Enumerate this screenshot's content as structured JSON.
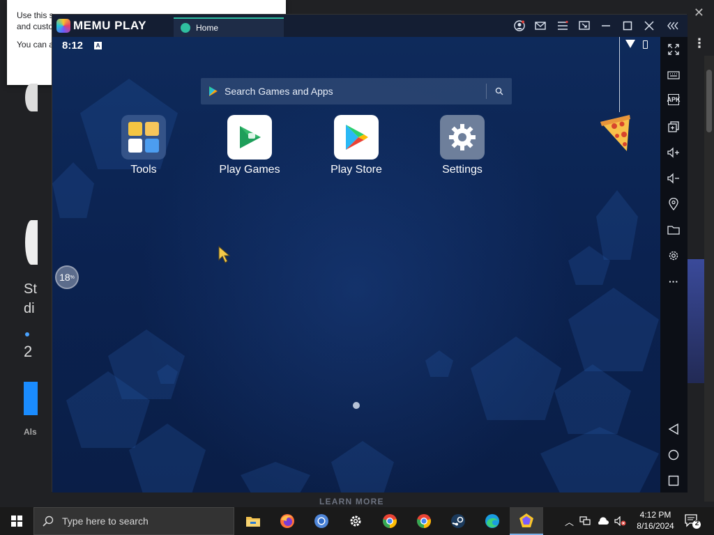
{
  "background_browser": {
    "notice_line1": "Use this s",
    "notice_line1_end": "Y",
    "notice_line2": "and custo",
    "notice_line3": "You can a",
    "page_text_1": "St",
    "page_text_2": "di",
    "page_text_3": "2",
    "page_text_4": "Als"
  },
  "emulator": {
    "brand": "MEMU PLAY",
    "tab_home": "Home",
    "status_time": "8:12",
    "search_placeholder": "Search Games and Apps",
    "apps": [
      {
        "label": "Tools",
        "icon": "tools-folder-icon"
      },
      {
        "label": "Play Games",
        "icon": "play-games-icon"
      },
      {
        "label": "Play Store",
        "icon": "play-store-icon"
      },
      {
        "label": "Settings",
        "icon": "settings-gear-icon"
      }
    ],
    "loading_value": "18",
    "loading_unit": "%",
    "sidebar_icons": [
      "fullscreen-icon",
      "keyboard-icon",
      "apk-icon",
      "multi-instance-icon",
      "volume-up-icon",
      "volume-down-icon",
      "location-icon",
      "folder-icon",
      "settings-icon",
      "more-icon",
      "back-icon",
      "home-icon",
      "recents-icon"
    ],
    "titlebar_icons": [
      "account-icon",
      "mail-icon",
      "menu-icon",
      "screen-icon",
      "minimize-icon",
      "maximize-icon",
      "close-icon",
      "collapse-sidebar-icon"
    ]
  },
  "learn_more": "LEARN MORE",
  "taskbar": {
    "search_placeholder": "Type here to search",
    "apps": [
      "file-explorer-icon",
      "firefox-icon",
      "chromium-icon",
      "settings-icon",
      "chrome-icon",
      "chrome-alt-icon",
      "steam-icon",
      "edge-icon",
      "memu-icon"
    ],
    "time": "4:12 PM",
    "date": "8/16/2024",
    "notification_count": "2"
  },
  "colors": {
    "emulator_bg": "#0b2250",
    "tab_accent": "#2fbfa0",
    "taskbar": "#1a1a1a"
  }
}
